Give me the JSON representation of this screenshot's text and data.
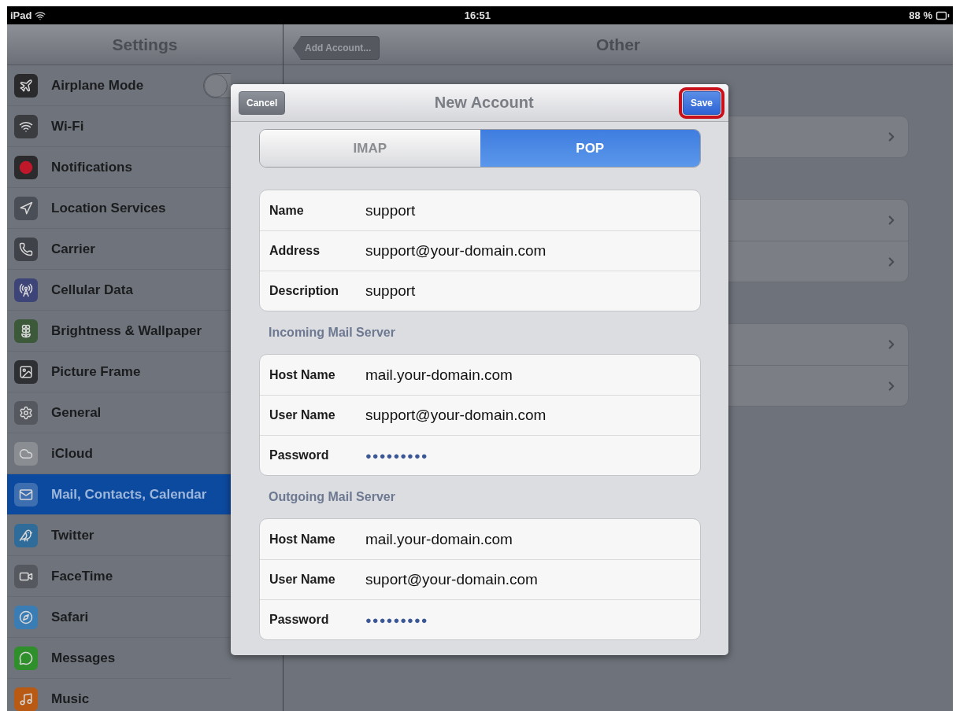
{
  "status_bar": {
    "device": "iPad",
    "time": "16:51",
    "battery": "88 %"
  },
  "sidebar": {
    "title": "Settings",
    "items": [
      {
        "label": "Airplane Mode",
        "selected": false,
        "color": "#2a2a2c",
        "toggle": {
          "on": false
        }
      },
      {
        "label": "Wi-Fi",
        "selected": false,
        "color": "#3a3c40"
      },
      {
        "label": "Notifications",
        "selected": false,
        "color": "#2b2b2e"
      },
      {
        "label": "Location Services",
        "selected": false,
        "color": "#4a4e56"
      },
      {
        "label": "Carrier",
        "selected": false,
        "color": "#3f4248"
      },
      {
        "label": "Cellular Data",
        "selected": false,
        "color": "#3d4478"
      },
      {
        "label": "Brightness & Wallpaper",
        "selected": false,
        "color": "#3c5a3a"
      },
      {
        "label": "Picture Frame",
        "selected": false,
        "color": "#2e3033"
      },
      {
        "label": "General",
        "selected": false,
        "color": "#55585e"
      },
      {
        "label": "iCloud",
        "selected": false,
        "color": "#8a8d92"
      },
      {
        "label": "Mail, Contacts, Calendar",
        "selected": true,
        "color": "#3d6fb0"
      },
      {
        "label": "Twitter",
        "selected": false,
        "color": "#2f6c9a"
      },
      {
        "label": "FaceTime",
        "selected": false,
        "color": "#55585e"
      },
      {
        "label": "Safari",
        "selected": false,
        "color": "#3a7db5"
      },
      {
        "label": "Messages",
        "selected": false,
        "color": "#2f8f2a"
      },
      {
        "label": "Music",
        "selected": false,
        "color": "#b85a14"
      }
    ]
  },
  "detail": {
    "back_button": "Add Account...",
    "title": "Other",
    "groups": [
      {
        "rows": [
          {
            "kind": "link"
          }
        ]
      },
      {
        "rows": [
          {
            "kind": "link"
          },
          {
            "kind": "link"
          }
        ]
      },
      {
        "rows": [
          {
            "kind": "link"
          },
          {
            "kind": "link"
          }
        ]
      }
    ]
  },
  "dialog": {
    "title": "New Account",
    "cancel": "Cancel",
    "save": "Save",
    "save_highlighted": true,
    "segments": [
      {
        "label": "IMAP",
        "selected": false
      },
      {
        "label": "POP",
        "selected": true
      }
    ],
    "sections": [
      {
        "fields": [
          {
            "label": "Name",
            "value": "support"
          },
          {
            "label": "Address",
            "value": "support@your-domain.com"
          },
          {
            "label": "Description",
            "value": "support"
          }
        ]
      },
      {
        "header": "Incoming Mail Server",
        "fields": [
          {
            "label": "Host Name",
            "value": "mail.your-domain.com"
          },
          {
            "label": "User Name",
            "value": "support@your-domain.com"
          },
          {
            "label": "Password",
            "value": "●●●●●●●●●",
            "kind": "secret"
          }
        ]
      },
      {
        "header": "Outgoing Mail Server",
        "fields": [
          {
            "label": "Host Name",
            "value": "mail.your-domain.com"
          },
          {
            "label": "User Name",
            "value": "suport@your-domain.com"
          },
          {
            "label": "Password",
            "value": "●●●●●●●●●",
            "kind": "secret"
          }
        ]
      }
    ]
  }
}
